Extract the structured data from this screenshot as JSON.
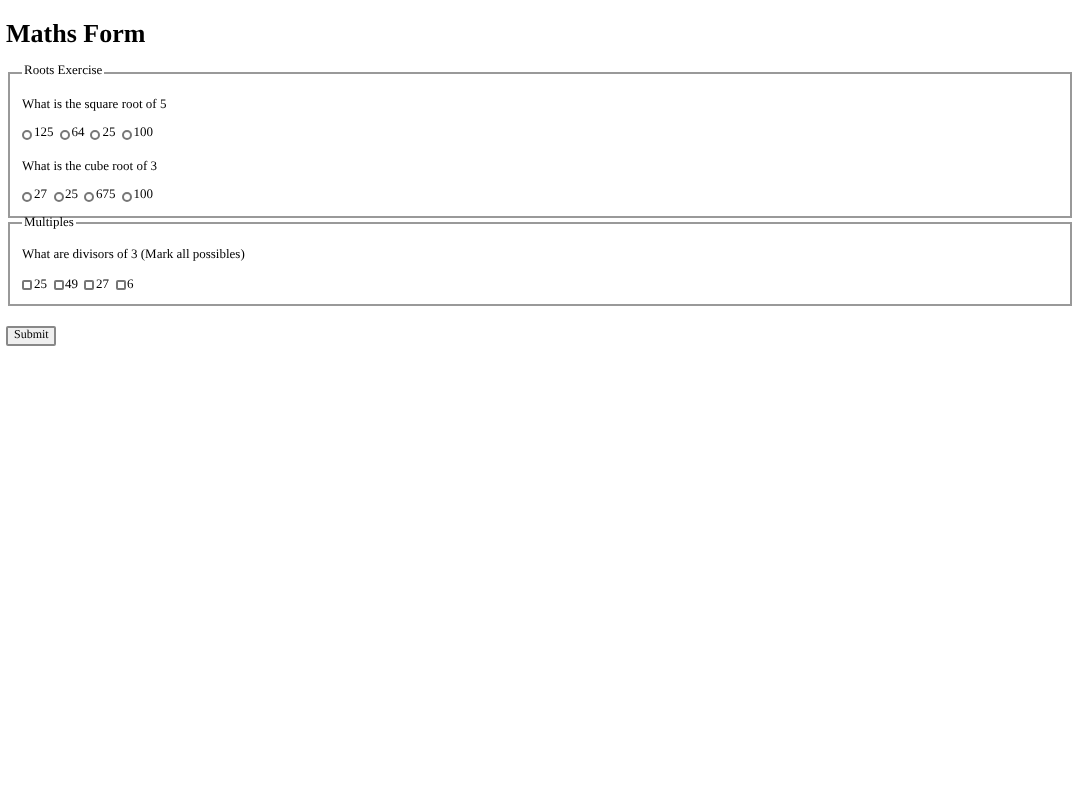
{
  "title": "Maths Form",
  "sections": [
    {
      "legend": "Roots Exercise",
      "questions": [
        {
          "text": "What is the square root of 5",
          "kind": "radio",
          "options": [
            {
              "label": "125",
              "checked": false
            },
            {
              "label": "64",
              "checked": false
            },
            {
              "label": "25",
              "checked": false
            },
            {
              "label": "100",
              "checked": false
            }
          ]
        },
        {
          "text": "What is the cube root of 3",
          "kind": "radio",
          "options": [
            {
              "label": "27",
              "checked": false
            },
            {
              "label": "25",
              "checked": false
            },
            {
              "label": "675",
              "checked": false
            },
            {
              "label": "100",
              "checked": false
            }
          ]
        }
      ]
    },
    {
      "legend": "Multiples",
      "questions": [
        {
          "text": "What are divisors of 3 (Mark all possibles)",
          "kind": "checkbox",
          "options": [
            {
              "label": "25",
              "checked": false
            },
            {
              "label": "49",
              "checked": false
            },
            {
              "label": "27",
              "checked": false
            },
            {
              "label": "6",
              "checked": false
            }
          ]
        }
      ]
    }
  ],
  "submit": "Submit"
}
